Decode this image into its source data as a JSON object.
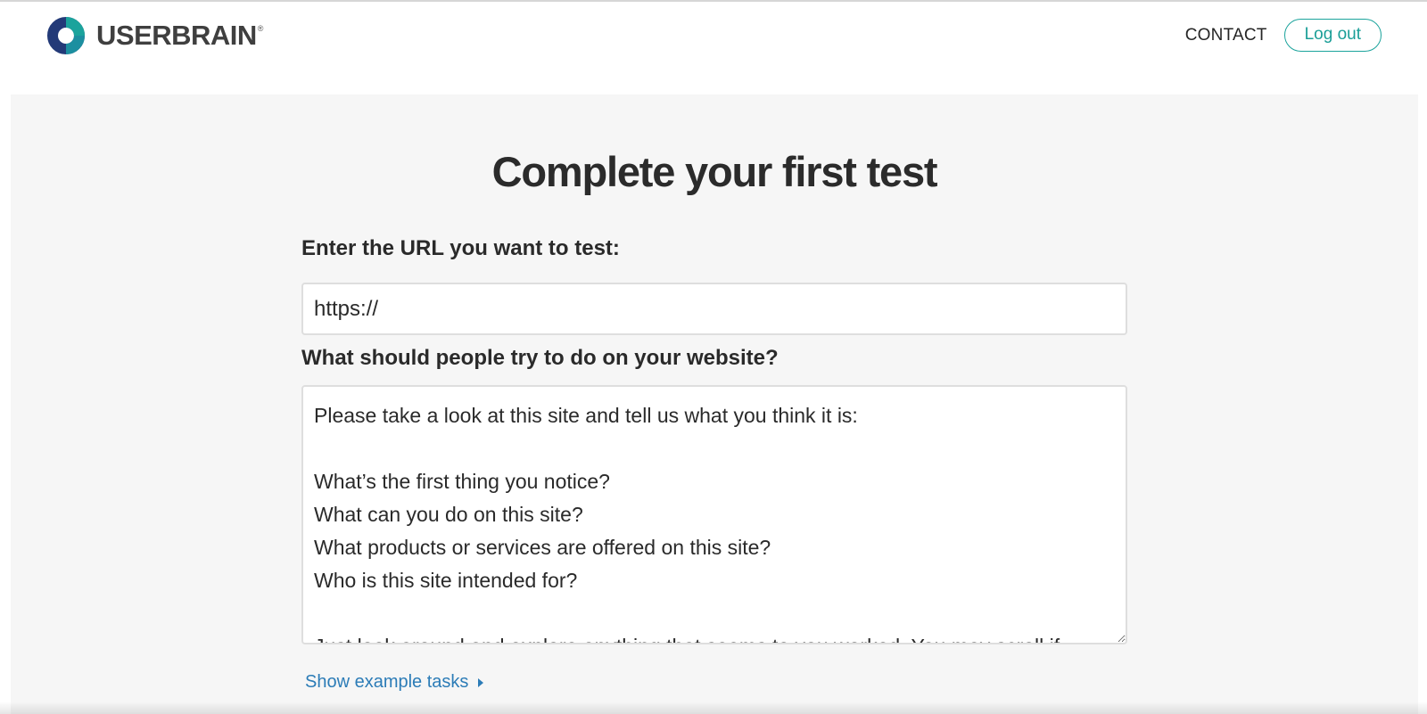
{
  "header": {
    "logo_text": "USERBRAIN",
    "logo_reg": "®",
    "logo_icon": "userbrain-ring-logo-icon",
    "nav": {
      "contact_label": "CONTACT",
      "logout_label": "Log out"
    }
  },
  "main": {
    "title": "Complete your first test",
    "url_label": "Enter the URL you want to test:",
    "url_value": "https://",
    "task_label": "What should people try to do on your website?",
    "task_value": "Please take a look at this site and tell us what you think it is:\n\nWhat’s the first thing you notice?\nWhat can you do on this site?\nWhat products or services are offered on this site?\nWho is this site intended for?\n\nJust look around and explore anything that seems to you worked. You may scroll if",
    "show_examples_label": "Show example tasks",
    "show_examples_icon": "caret-right-icon"
  },
  "colors": {
    "accent_teal": "#1ba39c",
    "link_blue": "#2c7cb7",
    "logo_dark_blue": "#233a78",
    "background_gray": "#f6f6f6"
  }
}
